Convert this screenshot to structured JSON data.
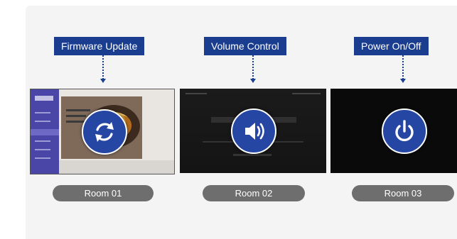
{
  "panels": [
    {
      "label": "Firmware Update",
      "room": "Room 01",
      "icon": "refresh-icon"
    },
    {
      "label": "Volume Control",
      "room": "Room 02",
      "icon": "speaker-icon"
    },
    {
      "label": "Power On/Off",
      "room": "Room 03",
      "icon": "power-icon"
    }
  ],
  "colors": {
    "label_bg": "#1a3d8f",
    "icon_bg": "#2546a3",
    "room_pill": "#6e6e6e",
    "panel_bg": "#f4f4f4"
  }
}
